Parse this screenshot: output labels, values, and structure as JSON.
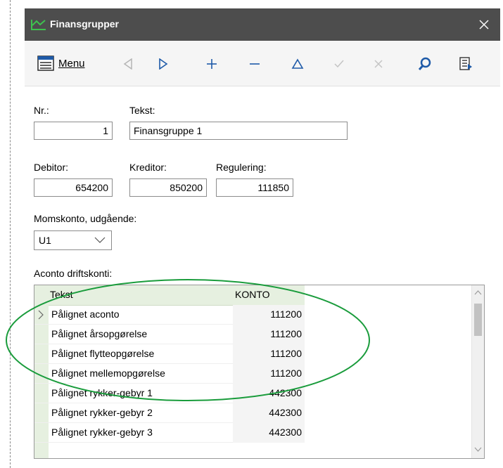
{
  "window": {
    "title": "Finansgrupper",
    "icons": {
      "app": "chart-app-icon",
      "close": "close-icon"
    }
  },
  "toolbar": {
    "menu_label": "Menu",
    "menu_icon": "menu-icon",
    "buttons": [
      "previous-icon",
      "next-icon",
      "add-icon",
      "remove-icon",
      "up-icon",
      "confirm-icon",
      "cancel-icon",
      "search-icon",
      "export-icon"
    ]
  },
  "form": {
    "nr_label": "Nr.:",
    "nr_value": "1",
    "tekst_label": "Tekst:",
    "tekst_value": "Finansgruppe 1",
    "debitor_label": "Debitor:",
    "debitor_value": "654200",
    "kreditor_label": "Kreditor:",
    "kreditor_value": "850200",
    "regulering_label": "Regulering:",
    "regulering_value": "111850",
    "moms_label": "Momskonto, udgående:",
    "moms_value": "U1"
  },
  "grid": {
    "title": "Aconto driftskonti:",
    "columns": [
      "Tekst",
      "KONTO"
    ],
    "rows": [
      {
        "tekst": "Pålignet aconto",
        "konto": "111200"
      },
      {
        "tekst": "Pålignet årsopgørelse",
        "konto": "111200"
      },
      {
        "tekst": "Pålignet flytteopgørelse",
        "konto": "111200"
      },
      {
        "tekst": "Pålignet mellemopgørelse",
        "konto": "111200"
      },
      {
        "tekst": "Pålignet rykker-gebyr 1",
        "konto": "442300"
      },
      {
        "tekst": "Pålignet rykker-gebyr 2",
        "konto": "442300"
      },
      {
        "tekst": "Pålignet rykker-gebyr 3",
        "konto": "442300"
      }
    ]
  },
  "colors": {
    "titlebar": "#4d4d4d",
    "accent_green": "#1a9c3c",
    "grid_header": "#e6f0e0",
    "search_blue": "#1e5aa8"
  }
}
